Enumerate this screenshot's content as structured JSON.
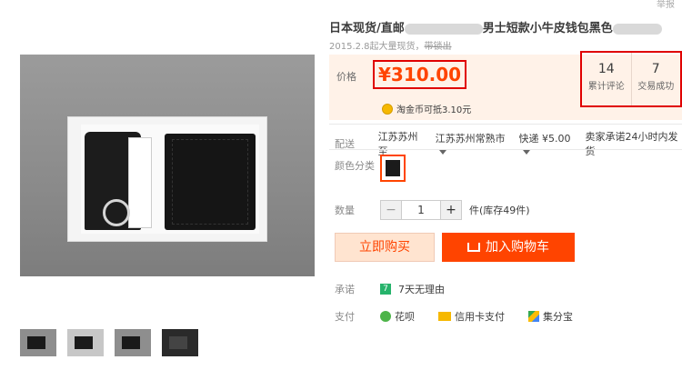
{
  "report": "举报",
  "title": {
    "prefix": "日本现货/直邮",
    "suffix": "男士短款小牛皮钱包黑色"
  },
  "subtitle": {
    "date_text": "2015.2.8起大量现货，",
    "strike_text": "带锁出"
  },
  "price": {
    "label": "价格",
    "value": "¥310.00"
  },
  "coin": {
    "text": "淘金币可抵3.10元"
  },
  "stats": {
    "reviews_count": "14",
    "reviews_label": "累计评论",
    "trades_count": "7",
    "trades_label": "交易成功"
  },
  "delivery": {
    "label": "配送",
    "from": "江苏苏州 至",
    "to": "江苏苏州常熟市",
    "express": "快递 ¥5.00",
    "promise": "卖家承诺24小时内发货"
  },
  "color": {
    "label": "颜色分类"
  },
  "quantity": {
    "label": "数量",
    "minus": "−",
    "value": "1",
    "plus": "+",
    "stock": "件(库存49件)"
  },
  "buttons": {
    "buy_now": "立即购买",
    "add_cart": "加入购物车"
  },
  "promise": {
    "label": "承诺",
    "icon": "7",
    "text": "7天无理由"
  },
  "payment": {
    "label": "支付",
    "methods": [
      "花呗",
      "信用卡支付",
      "集分宝"
    ]
  },
  "colors": {
    "accent": "#ff4400",
    "price_red": "#e00000"
  }
}
